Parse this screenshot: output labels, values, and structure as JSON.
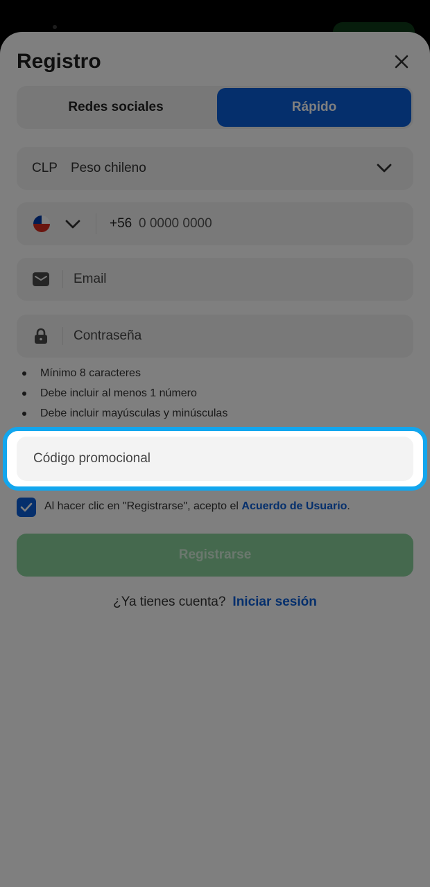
{
  "header": {
    "title": "Registro"
  },
  "tabs": [
    {
      "label": "Redes sociales",
      "active": false
    },
    {
      "label": "Rápido",
      "active": true
    }
  ],
  "currency": {
    "code": "CLP",
    "name": "Peso chileno"
  },
  "phone": {
    "country": "Chile",
    "prefix": "+56",
    "placeholder": "0 0000 0000"
  },
  "email": {
    "placeholder": "Email"
  },
  "password": {
    "placeholder": "Contraseña",
    "rules": [
      "Mínimo 8 caracteres",
      "Debe incluir al menos 1 número",
      "Debe incluir mayúsculas y minúsculas"
    ]
  },
  "promo": {
    "placeholder": "Código promocional"
  },
  "agreement": {
    "checked": true,
    "text": "Al hacer clic en \"Registrarse\", acepto el",
    "link": "Acuerdo de Usuario",
    "suffix": "."
  },
  "submit": {
    "label": "Registrarse"
  },
  "login": {
    "prompt": "¿Ya tienes cuenta?",
    "link": "Iniciar sesión"
  },
  "colors": {
    "accent": "#0a5fd8",
    "highlight": "#12a6ee",
    "submit": "#8ad29c"
  }
}
